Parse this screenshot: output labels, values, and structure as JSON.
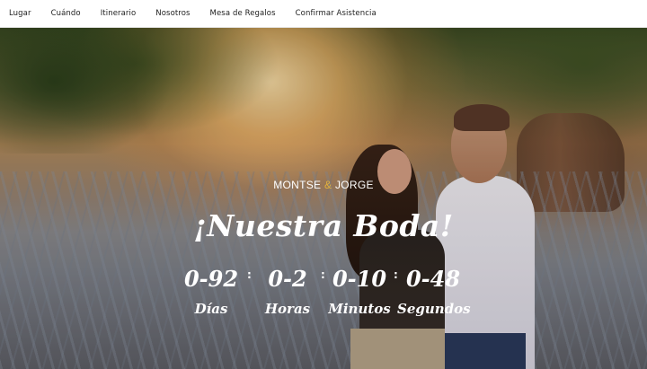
{
  "nav": {
    "items": [
      "Lugar",
      "Cuándo",
      "Itinerario",
      "Nosotros",
      "Mesa de Regalos",
      "Confirmar Asistencia"
    ]
  },
  "hero": {
    "names_left": "MONTSE",
    "names_amp": "&",
    "names_right": "JORGE",
    "title": "¡Nuestra Boda!",
    "separator": ":",
    "countdown": [
      {
        "value": "0-92",
        "label": "Días"
      },
      {
        "value": "0-2",
        "label": "Horas"
      },
      {
        "value": "0-10",
        "label": "Minutos"
      },
      {
        "value": "0-48",
        "label": "Segundos"
      }
    ]
  },
  "colors": {
    "accent": "#e2b13c",
    "nav_bg": "#ffffff",
    "text_on_photo": "#ffffff"
  }
}
